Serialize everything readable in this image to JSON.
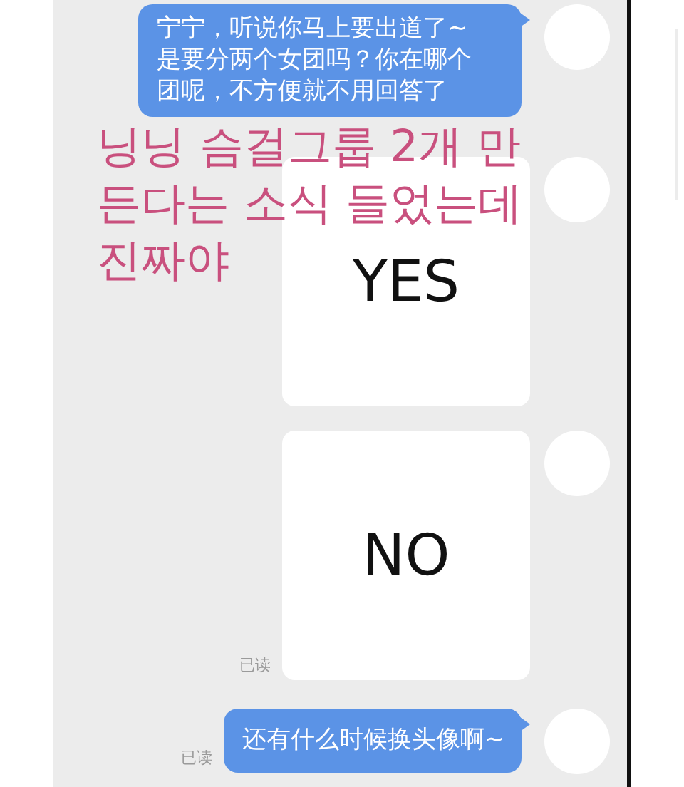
{
  "messages": [
    {
      "kind": "text",
      "text": "宁宁，听说你马上要出道了~是要分两个女团吗？你在哪个团呢，不方便就不用回答了"
    },
    {
      "kind": "card",
      "text": "YES"
    },
    {
      "kind": "card",
      "text": "NO",
      "read_label": "已读"
    },
    {
      "kind": "text",
      "text": "还有什么时候换头像啊~",
      "read_label": "已读"
    }
  ],
  "caption": {
    "lines": [
      "닝닝 슴걸그룹 2개 만",
      "든다는 소식 들었는데",
      "진짜야"
    ]
  }
}
